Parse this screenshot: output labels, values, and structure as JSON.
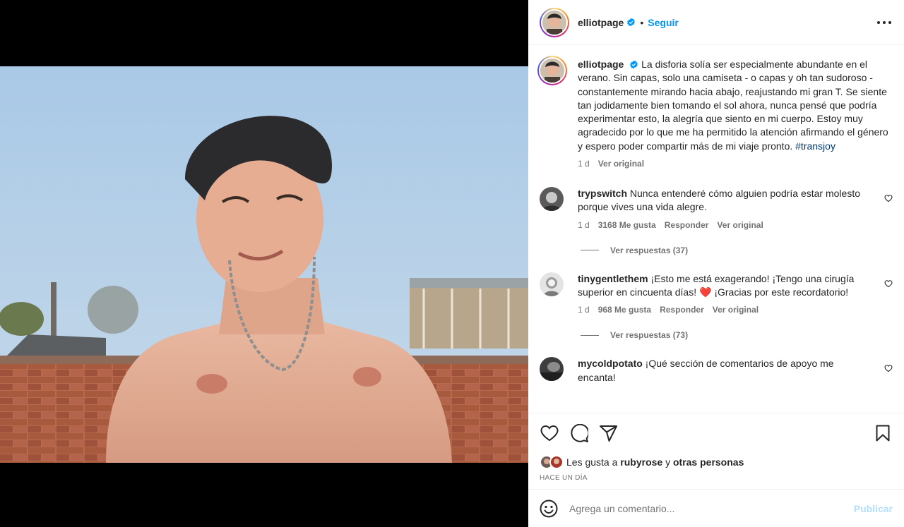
{
  "post": {
    "username": "elliotpage",
    "follow_label": "Seguir",
    "separator": "•",
    "caption_text": "La disforia solía ser especialmente abundante en el verano. Sin capas, solo una camiseta - o capas y oh tan sudoroso - constantemente mirando hacia abajo, reajustando mi gran T. Se siente tan jodidamente bien tomando el sol ahora, nunca pensé que podría experimentar esto, la alegría que siento en mi cuerpo. Estoy muy agradecido por lo que me ha permitido la atención afirmando el género y espero poder compartir más de mi viaje pronto.",
    "hashtag": "#transjoy",
    "caption_age": "1 d",
    "see_original": "Ver original"
  },
  "comments": [
    {
      "username": "trypswitch",
      "text": "Nunca entenderé cómo alguien podría estar molesto porque vives una vida alegre.",
      "age": "1 d",
      "likes": "3168 Me gusta",
      "reply": "Responder",
      "see_original": "Ver original",
      "replies_label": "Ver respuestas (37)"
    },
    {
      "username": "tinygentlethem",
      "text": "¡Esto me está exagerando! ¡Tengo una cirugía superior en cincuenta días! ❤️ ¡Gracias por este recordatorio!",
      "age": "1 d",
      "likes": "968 Me gusta",
      "reply": "Responder",
      "see_original": "Ver original",
      "replies_label": "Ver respuestas (73)"
    },
    {
      "username": "mycoldpotato",
      "text": "¡Qué sección de comentarios de apoyo me encanta!"
    }
  ],
  "likes_line": {
    "prefix": "Les gusta a",
    "user": "rubyrose",
    "conj": "y",
    "others": "otras personas"
  },
  "timestamp": "HACE UN DÍA",
  "add_comment": {
    "placeholder": "Agrega un comentario...",
    "publish": "Publicar"
  },
  "icons": [
    "verified-icon",
    "more-options-icon",
    "like-icon",
    "comment-icon",
    "share-icon",
    "save-icon",
    "emoji-icon",
    "heart-icon"
  ],
  "colors": {
    "accent": "#0095f6",
    "hashtag": "#00376b",
    "muted": "#737373",
    "publish_disabled": "#b2dffc"
  }
}
